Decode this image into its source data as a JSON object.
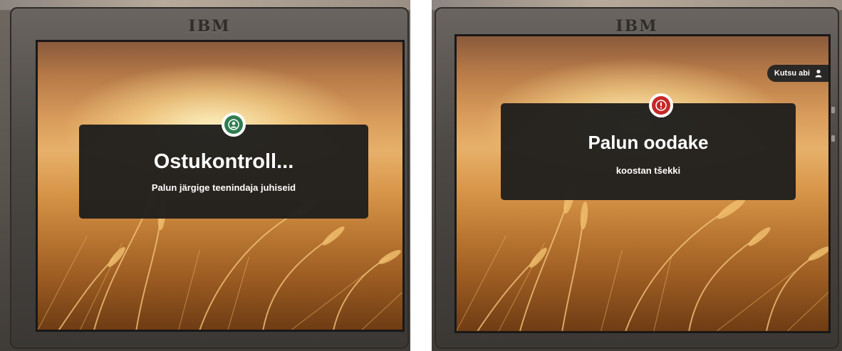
{
  "screens": [
    {
      "brand": "IBM",
      "status_icon": "user-circle-icon",
      "status_color": "#2e7d4f",
      "title": "Ostukontroll...",
      "message": "Palun järgige teenindaja juhiseid"
    },
    {
      "brand": "IBM",
      "status_icon": "alert-exclamation-icon",
      "status_color": "#c62828",
      "title": "Palun oodake",
      "message": "koostan tšekki",
      "help_button": {
        "label": "Kutsu abi",
        "icon": "person-icon"
      }
    }
  ],
  "colors": {
    "dialog": "#1f1e1c",
    "bezel": "#4d4945",
    "wheat": "#d8964a"
  }
}
